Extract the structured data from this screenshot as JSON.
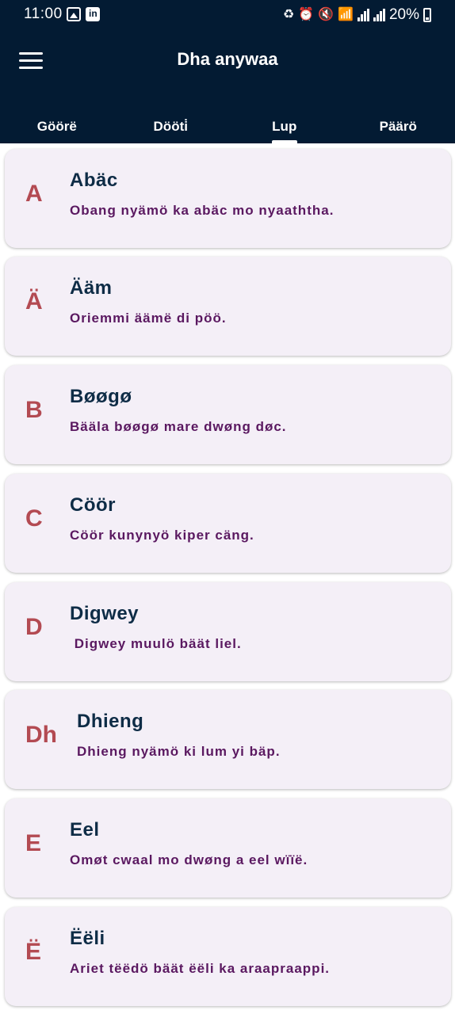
{
  "status_bar": {
    "time": "11:00",
    "battery_text": "20%",
    "left_icons": [
      "gallery-icon",
      "linkedin-icon"
    ],
    "right_icons": [
      "recycle-icon",
      "alarm-icon",
      "mute-icon",
      "wifi-icon",
      "signal-icon",
      "signal-icon",
      "battery-icon"
    ]
  },
  "app_bar": {
    "title": "Dha anywaa",
    "menu_icon": "menu-icon",
    "background_color": "#031b33"
  },
  "tabs": [
    {
      "label": "Göörë",
      "active": false
    },
    {
      "label": "Dööti̇",
      "active": false
    },
    {
      "label": "Lup",
      "active": true
    },
    {
      "label": "Päärö",
      "active": false
    }
  ],
  "entries": [
    {
      "letter": "A",
      "word": "Abäc",
      "sentence": "Obang nyämö ka abäc mo nyaaththa."
    },
    {
      "letter": "Ä",
      "word": "Ääm",
      "sentence": "Oriemmi äämë di pöö."
    },
    {
      "letter": "B",
      "word": "Bøøgø",
      "sentence": "Bääla bøøgø mare dwøng døc."
    },
    {
      "letter": "C",
      "word": "Cöör",
      "sentence": "Cöör kunynyö kiper cäng."
    },
    {
      "letter": "D",
      "word": "Digwey",
      "sentence": " Digwey muulö bäät liel."
    },
    {
      "letter": "Dh",
      "word": "Dhieng",
      "sentence": "Dhieng nyämö ki lum yi bäp."
    },
    {
      "letter": "E",
      "word": "Eel",
      "sentence": "Omøt cwaal mo dwøng a eel wïïë."
    },
    {
      "letter": "Ë",
      "word": "Ëëli",
      "sentence": "Ariet tëëdö bäät ëëli ka araapraappi."
    }
  ],
  "colors": {
    "letter": "#b34a52",
    "word": "#0e2c46",
    "sentence": "#5a1860",
    "card_bg": "#f4eff7"
  }
}
